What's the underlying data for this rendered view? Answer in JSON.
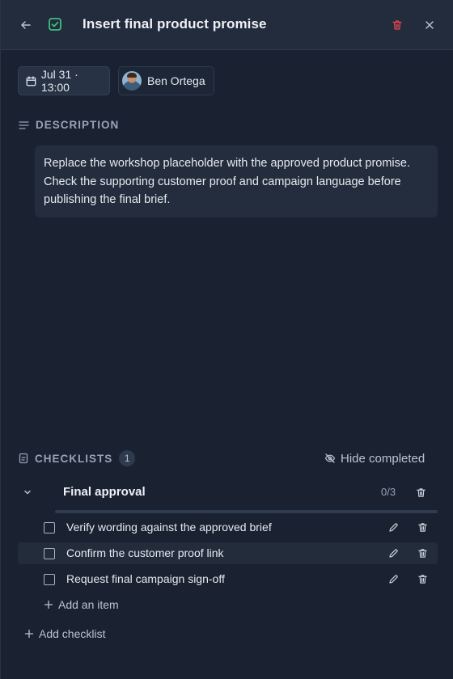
{
  "header": {
    "title": "Insert final product promise",
    "icons": {
      "back": "arrow-left-icon",
      "status": "check-square-icon",
      "delete": "trash-icon",
      "close": "close-icon"
    },
    "status_color": "#3fbf7f",
    "delete_color": "#e5484d"
  },
  "meta": {
    "due": "Jul 31 · 13:00",
    "assignee": "Ben Ortega"
  },
  "description": {
    "heading": "DESCRIPTION",
    "text": "Replace the workshop placeholder with the approved product promise. Check the supporting customer proof and campaign language before publishing the final brief."
  },
  "checklists": {
    "heading": "CHECKLISTS",
    "count": "1",
    "hide_completed_label": "Hide completed",
    "lists": [
      {
        "title": "Final approval",
        "progress_text": "0/3",
        "progress_fraction": 0,
        "items": [
          {
            "label": "Verify wording against the approved brief",
            "checked": false
          },
          {
            "label": "Confirm the customer proof link",
            "checked": false
          },
          {
            "label": "Request final campaign sign-off",
            "checked": false
          }
        ],
        "add_item_label": "Add an item"
      }
    ],
    "add_checklist_label": "Add checklist"
  }
}
